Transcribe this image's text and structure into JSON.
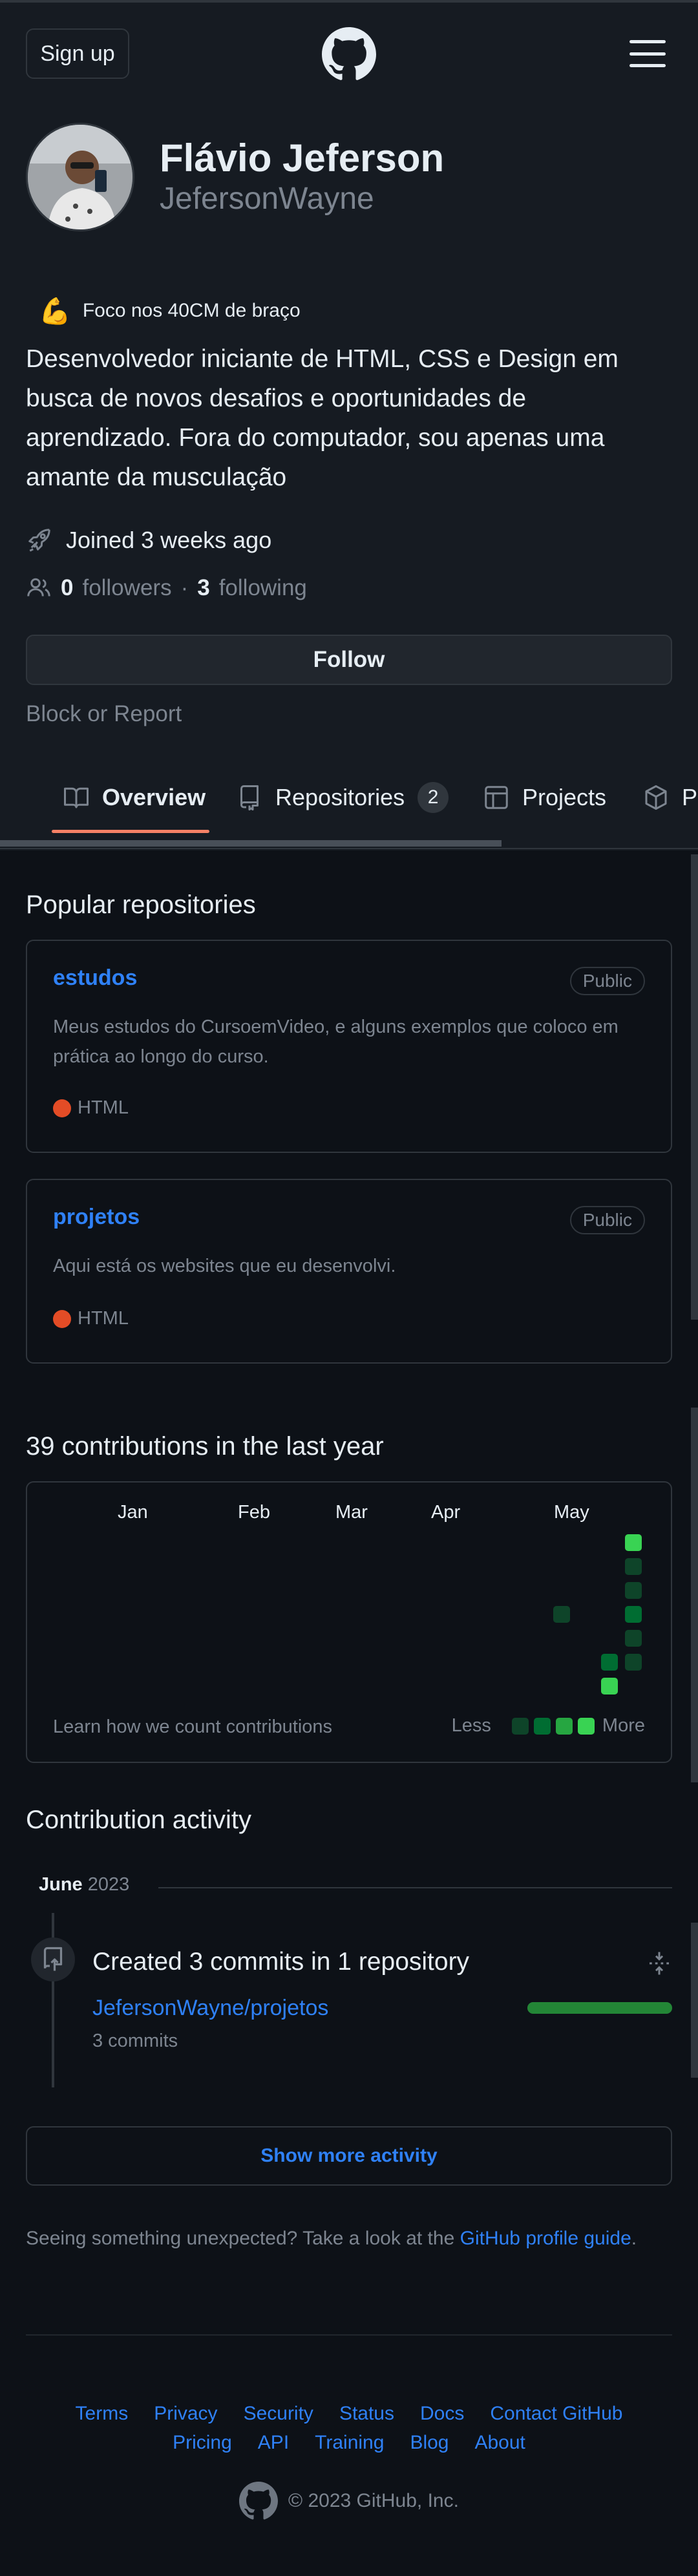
{
  "header": {
    "signup_label": "Sign up"
  },
  "profile": {
    "full_name": "Flávio Jeferson",
    "username": "JefersonWayne",
    "status_emoji": "💪",
    "status_text": "Foco nos 40CM de braço",
    "bio": "Desenvolvedor iniciante de HTML, CSS e Design em busca de novos desafios e oportunidades de aprendizado. Fora do computador, sou apenas uma amante da musculação",
    "joined": "Joined 3 weeks ago",
    "followers_count": "0",
    "followers_label": "followers",
    "separator": "·",
    "following_count": "3",
    "following_label": "following",
    "follow_label": "Follow",
    "block_report_label": "Block or Report"
  },
  "tabs": [
    {
      "label": "Overview"
    },
    {
      "label": "Repositories",
      "count": "2"
    },
    {
      "label": "Projects"
    },
    {
      "label": "P"
    }
  ],
  "popular": {
    "title": "Popular repositories",
    "repos": [
      {
        "name": "estudos",
        "visibility": "Public",
        "description": "Meus estudos do CursoemVideo, e alguns exemplos que coloco em prática ao longo do curso.",
        "language": "HTML",
        "language_color": "#e34c26"
      },
      {
        "name": "projetos",
        "visibility": "Public",
        "description": "Aqui está os websites que eu desenvolvi.",
        "language": "HTML",
        "language_color": "#e34c26"
      }
    ]
  },
  "contributions": {
    "title": "39 contributions in the last year",
    "months": [
      "Jan",
      "Feb",
      "Mar",
      "Apr",
      "May"
    ],
    "learn_label": "Learn how we count contributions",
    "less_label": "Less",
    "more_label": "More",
    "legend_colors": [
      "#0e4429",
      "#006d32",
      "#26a641",
      "#39d353"
    ]
  },
  "activity": {
    "title": "Contribution activity",
    "month": "June",
    "year": "2023",
    "summary": "Created 3 commits in 1 repository",
    "repo": "JefersonWayne/projetos",
    "commits": "3 commits",
    "bar_fraction": 1.0,
    "show_more_label": "Show more activity",
    "unexpected_text": "Seeing something unexpected? Take a look at the",
    "guide_link": "GitHub profile guide",
    "guide_suffix": "."
  },
  "footer": {
    "row1": [
      "Terms",
      "Privacy",
      "Security",
      "Status",
      "Docs",
      "Contact GitHub"
    ],
    "row2": [
      "Pricing",
      "API",
      "Training",
      "Blog",
      "About"
    ],
    "copyright": "© 2023 GitHub, Inc."
  }
}
